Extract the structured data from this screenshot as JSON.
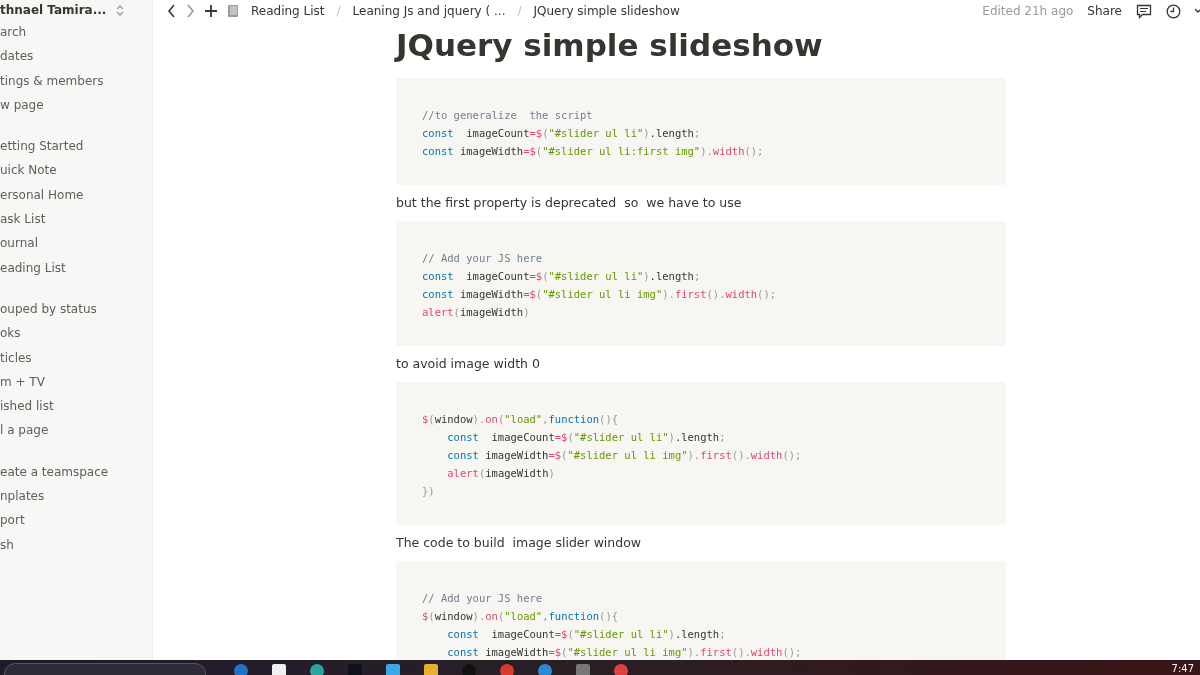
{
  "sidebar": {
    "workspace": "thnael Tamira...",
    "groups": [
      {
        "items": [
          {
            "label": "arch"
          },
          {
            "label": "dates"
          },
          {
            "label": "tings & members"
          },
          {
            "label": "w page"
          }
        ]
      },
      {
        "items": [
          {
            "label": "etting Started"
          },
          {
            "label": "uick Note"
          },
          {
            "label": "ersonal Home"
          },
          {
            "label": "ask List"
          },
          {
            "label": "ournal"
          },
          {
            "label": "eading List"
          }
        ]
      },
      {
        "items": [
          {
            "label": "ouped by status"
          },
          {
            "label": "oks"
          },
          {
            "label": "ticles"
          },
          {
            "label": "m + TV"
          },
          {
            "label": "ished list"
          },
          {
            "label": "l a page"
          }
        ]
      },
      {
        "items": [
          {
            "label": "eate a teamspace"
          },
          {
            "label": "nplates"
          },
          {
            "label": "port"
          },
          {
            "label": "sh"
          }
        ]
      }
    ]
  },
  "topbar": {
    "breadcrumbs": [
      "Reading List",
      "Leaning Js and jquery ( ...",
      "JQuery simple slideshow"
    ],
    "separators": [
      "/",
      "/"
    ],
    "edited": "Edited 21h ago",
    "share": "Share"
  },
  "page": {
    "title": "JQuery simple slideshow",
    "blocks": [
      {
        "kind": "code",
        "lines": [
          [
            {
              "kind": "comment",
              "text": "//to generalize  the script"
            }
          ],
          [
            {
              "kind": "keyword",
              "text": "const"
            },
            {
              "kind": "plain",
              "text": "  imageCount"
            },
            {
              "kind": "func",
              "text": "=$"
            },
            {
              "kind": "punct",
              "text": "("
            },
            {
              "kind": "string",
              "text": "\"#slider ul li\""
            },
            {
              "kind": "punct",
              "text": ")"
            },
            {
              "kind": "plain",
              "text": ".length"
            },
            {
              "kind": "punct",
              "text": ";"
            }
          ],
          [
            {
              "kind": "keyword",
              "text": "const"
            },
            {
              "kind": "plain",
              "text": " imageWidth"
            },
            {
              "kind": "func",
              "text": "=$"
            },
            {
              "kind": "punct",
              "text": "("
            },
            {
              "kind": "string",
              "text": "\"#slider ul li:first img\""
            },
            {
              "kind": "punct",
              "text": ")."
            },
            {
              "kind": "func",
              "text": "width"
            },
            {
              "kind": "punct",
              "text": "();"
            }
          ]
        ]
      },
      {
        "kind": "text",
        "text": "but the first property is deprecated  so  we have to use"
      },
      {
        "kind": "code",
        "lines": [
          [
            {
              "kind": "comment",
              "text": "// Add your JS here"
            }
          ],
          [
            {
              "kind": "keyword",
              "text": "const"
            },
            {
              "kind": "plain",
              "text": "  imageCount"
            },
            {
              "kind": "func",
              "text": "=$"
            },
            {
              "kind": "punct",
              "text": "("
            },
            {
              "kind": "string",
              "text": "\"#slider ul li\""
            },
            {
              "kind": "punct",
              "text": ")"
            },
            {
              "kind": "plain",
              "text": ".length"
            },
            {
              "kind": "punct",
              "text": ";"
            }
          ],
          [
            {
              "kind": "keyword",
              "text": "const"
            },
            {
              "kind": "plain",
              "text": " imageWidth"
            },
            {
              "kind": "func",
              "text": "=$"
            },
            {
              "kind": "punct",
              "text": "("
            },
            {
              "kind": "string",
              "text": "\"#slider ul li img\""
            },
            {
              "kind": "punct",
              "text": ")."
            },
            {
              "kind": "func",
              "text": "first"
            },
            {
              "kind": "punct",
              "text": "()."
            },
            {
              "kind": "func",
              "text": "width"
            },
            {
              "kind": "punct",
              "text": "();"
            }
          ],
          [
            {
              "kind": "func",
              "text": "alert"
            },
            {
              "kind": "punct",
              "text": "("
            },
            {
              "kind": "plain",
              "text": "imageWidth"
            },
            {
              "kind": "punct",
              "text": ")"
            }
          ]
        ]
      },
      {
        "kind": "text",
        "text": "to avoid image width 0"
      },
      {
        "kind": "code",
        "lines": [
          [
            {
              "kind": "func",
              "text": "$"
            },
            {
              "kind": "punct",
              "text": "("
            },
            {
              "kind": "plain",
              "text": "window"
            },
            {
              "kind": "punct",
              "text": ")."
            },
            {
              "kind": "func",
              "text": "on"
            },
            {
              "kind": "punct",
              "text": "("
            },
            {
              "kind": "string",
              "text": "\"load\""
            },
            {
              "kind": "punct",
              "text": ","
            },
            {
              "kind": "keyword",
              "text": "function"
            },
            {
              "kind": "punct",
              "text": "(){"
            }
          ],
          [
            {
              "kind": "keyword",
              "text": "    const"
            },
            {
              "kind": "plain",
              "text": "  imageCount"
            },
            {
              "kind": "func",
              "text": "=$"
            },
            {
              "kind": "punct",
              "text": "("
            },
            {
              "kind": "string",
              "text": "\"#slider ul li\""
            },
            {
              "kind": "punct",
              "text": ")"
            },
            {
              "kind": "plain",
              "text": ".length"
            },
            {
              "kind": "punct",
              "text": ";"
            }
          ],
          [
            {
              "kind": "keyword",
              "text": "    const"
            },
            {
              "kind": "plain",
              "text": " imageWidth"
            },
            {
              "kind": "func",
              "text": "=$"
            },
            {
              "kind": "punct",
              "text": "("
            },
            {
              "kind": "string",
              "text": "\"#slider ul li img\""
            },
            {
              "kind": "punct",
              "text": ")."
            },
            {
              "kind": "func",
              "text": "first"
            },
            {
              "kind": "punct",
              "text": "()."
            },
            {
              "kind": "func",
              "text": "width"
            },
            {
              "kind": "punct",
              "text": "();"
            }
          ],
          [
            {
              "kind": "func",
              "text": "    alert"
            },
            {
              "kind": "punct",
              "text": "("
            },
            {
              "kind": "plain",
              "text": "imageWidth"
            },
            {
              "kind": "punct",
              "text": ")"
            }
          ],
          [
            {
              "kind": "punct",
              "text": "})"
            }
          ]
        ]
      },
      {
        "kind": "text",
        "text": "The code to build  image slider window"
      },
      {
        "kind": "code",
        "lines": [
          [
            {
              "kind": "comment",
              "text": "// Add your JS here"
            }
          ],
          [
            {
              "kind": "func",
              "text": "$"
            },
            {
              "kind": "punct",
              "text": "("
            },
            {
              "kind": "plain",
              "text": "window"
            },
            {
              "kind": "punct",
              "text": ")."
            },
            {
              "kind": "func",
              "text": "on"
            },
            {
              "kind": "punct",
              "text": "("
            },
            {
              "kind": "string",
              "text": "\"load\""
            },
            {
              "kind": "punct",
              "text": ","
            },
            {
              "kind": "keyword",
              "text": "function"
            },
            {
              "kind": "punct",
              "text": "(){"
            }
          ],
          [
            {
              "kind": "keyword",
              "text": "    const"
            },
            {
              "kind": "plain",
              "text": "  imageCount"
            },
            {
              "kind": "func",
              "text": "=$"
            },
            {
              "kind": "punct",
              "text": "("
            },
            {
              "kind": "string",
              "text": "\"#slider ul li\""
            },
            {
              "kind": "punct",
              "text": ")"
            },
            {
              "kind": "plain",
              "text": ".length"
            },
            {
              "kind": "punct",
              "text": ";"
            }
          ],
          [
            {
              "kind": "keyword",
              "text": "    const"
            },
            {
              "kind": "plain",
              "text": " imageWidth"
            },
            {
              "kind": "func",
              "text": "=$"
            },
            {
              "kind": "punct",
              "text": "("
            },
            {
              "kind": "string",
              "text": "\"#slider ul li img\""
            },
            {
              "kind": "punct",
              "text": ")."
            },
            {
              "kind": "func",
              "text": "first"
            },
            {
              "kind": "punct",
              "text": "()."
            },
            {
              "kind": "func",
              "text": "width"
            },
            {
              "kind": "punct",
              "text": "();"
            }
          ]
        ]
      }
    ]
  },
  "taskbar": {
    "clock": "7:47"
  }
}
